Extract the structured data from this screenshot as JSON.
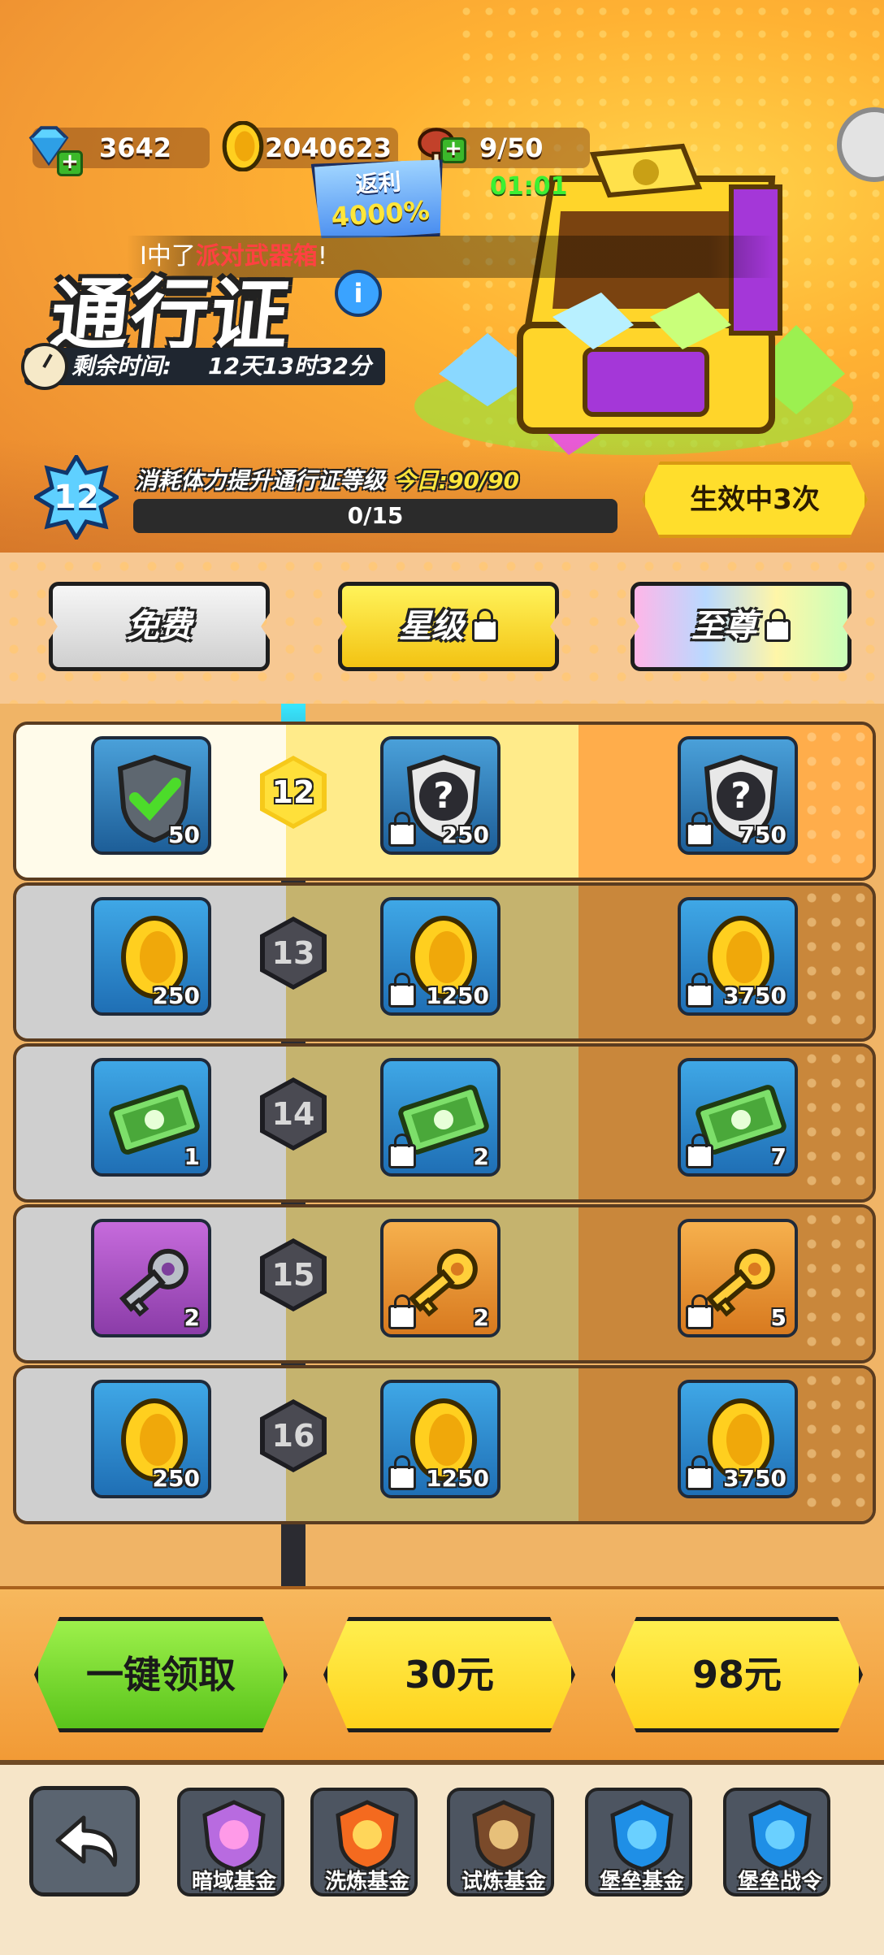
{
  "header": {
    "gems": "3642",
    "coins": "2040623",
    "stamina": "9/50",
    "stamina_timer": "01:01",
    "rebate_label": "返利",
    "rebate_value": "4000%",
    "ticker_prefix": "I中了",
    "ticker_item": "派对武器箱",
    "ticker_suffix": "!",
    "title": "通行证",
    "info_label": "i",
    "remaining_label": "剩余时间:",
    "remaining_value": "12天13时32分"
  },
  "level": {
    "current": "12",
    "description": "消耗体力提升通行证等级",
    "today_label": "今日:90/90",
    "progress_text": "0/15",
    "progress_fraction": 0,
    "effect_button": "生效中3次"
  },
  "tabs": [
    {
      "label": "免费",
      "locked": false
    },
    {
      "label": "星级",
      "locked": true
    },
    {
      "label": "至尊",
      "locked": true
    }
  ],
  "rows": [
    {
      "level": "12",
      "free": {
        "icon": "shield-check-icon",
        "qty": "50"
      },
      "star": {
        "icon": "shield-question-icon",
        "qty": "250"
      },
      "supreme": {
        "icon": "shield-question-icon",
        "qty": "750"
      }
    },
    {
      "level": "13",
      "free": {
        "icon": "coin-icon",
        "qty": "250"
      },
      "star": {
        "icon": "coin-icon",
        "qty": "1250"
      },
      "supreme": {
        "icon": "coin-icon",
        "qty": "3750"
      }
    },
    {
      "level": "14",
      "free": {
        "icon": "ticket-icon",
        "qty": "1"
      },
      "star": {
        "icon": "ticket-icon",
        "qty": "2"
      },
      "supreme": {
        "icon": "ticket-icon",
        "qty": "7"
      }
    },
    {
      "level": "15",
      "free": {
        "icon": "silver-key-icon",
        "qty": "2"
      },
      "star": {
        "icon": "gold-key-icon",
        "qty": "2"
      },
      "supreme": {
        "icon": "gold-key-icon",
        "qty": "5"
      }
    },
    {
      "level": "16",
      "free": {
        "icon": "coin-icon",
        "qty": "250"
      },
      "star": {
        "icon": "coin-icon",
        "qty": "1250"
      },
      "supreme": {
        "icon": "coin-icon",
        "qty": "3750"
      }
    }
  ],
  "actions": {
    "claim_all": "一键领取",
    "price_star": "30元",
    "price_supreme": "98元"
  },
  "nav": [
    {
      "label": "暗域基金",
      "icon": "dark-fund-icon"
    },
    {
      "label": "洗炼基金",
      "icon": "refine-fund-icon"
    },
    {
      "label": "试炼基金",
      "icon": "trial-fund-icon"
    },
    {
      "label": "堡垒基金",
      "icon": "fortress-fund-icon"
    },
    {
      "label": "堡垒战令",
      "icon": "fortress-pass-icon"
    }
  ],
  "colors": {
    "accent_yellow": "#ffde2c",
    "claim_green": "#5ac41b",
    "header_orange": "#f39a34"
  }
}
